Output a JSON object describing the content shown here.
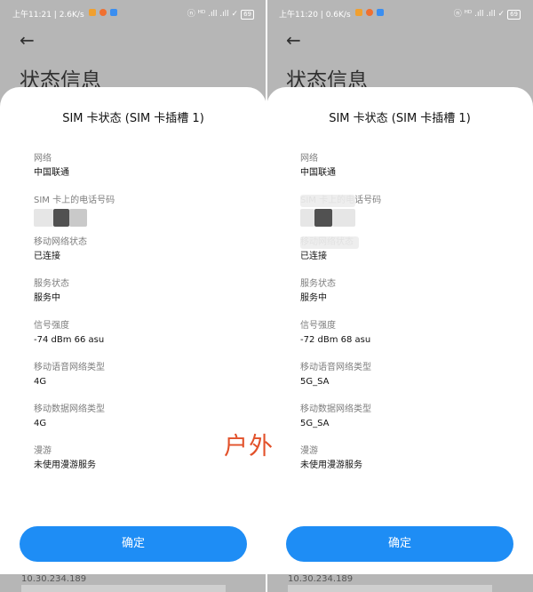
{
  "panels": {
    "left": {
      "status_time": "上午11:21 | 2.6K/s",
      "status_icons": "ⓝ ᴴᴰ .ıll .ıll ✓",
      "battery": "69",
      "page_title": "状态信息",
      "sheet_title": "SIM 卡状态 (SIM 卡插槽 1)",
      "rows": [
        {
          "label": "网络",
          "value": "中国联通"
        },
        {
          "label": "SIM 卡上的电话号码",
          "value": ""
        },
        {
          "label": "移动网络状态",
          "value": "已连接"
        },
        {
          "label": "服务状态",
          "value": "服务中"
        },
        {
          "label": "信号强度",
          "value": "-74 dBm 66 asu"
        },
        {
          "label": "移动语音网络类型",
          "value": "4G"
        },
        {
          "label": "移动数据网络类型",
          "value": "4G"
        },
        {
          "label": "漫游",
          "value": "未使用漫游服务"
        }
      ],
      "confirm_label": "确定",
      "below_text": "10.30.234.189"
    },
    "right": {
      "status_time": "上午11:20 | 0.6K/s",
      "status_icons": "ⓝ ᴴᴰ .ıll .ıll ✓",
      "battery": "69",
      "page_title": "状态信息",
      "sheet_title": "SIM 卡状态 (SIM 卡插槽 1)",
      "rows": [
        {
          "label": "网络",
          "value": "中国联通"
        },
        {
          "label": "SIM 卡上的电话号码",
          "value": ""
        },
        {
          "label": "移动网络状态",
          "value": "已连接"
        },
        {
          "label": "服务状态",
          "value": "服务中"
        },
        {
          "label": "信号强度",
          "value": "-72 dBm 68 asu"
        },
        {
          "label": "移动语音网络类型",
          "value": "5G_SA"
        },
        {
          "label": "移动数据网络类型",
          "value": "5G_SA"
        },
        {
          "label": "漫游",
          "value": "未使用漫游服务"
        }
      ],
      "confirm_label": "确定",
      "below_text": "10.30.234.189"
    }
  },
  "overlay_caption": "户外",
  "colors": {
    "accent": "#1e8df5",
    "caption": "#e2512a",
    "background_dim": "#b6b6b6"
  },
  "icons": [
    "back-arrow-icon",
    "signal-icon",
    "battery-icon"
  ]
}
